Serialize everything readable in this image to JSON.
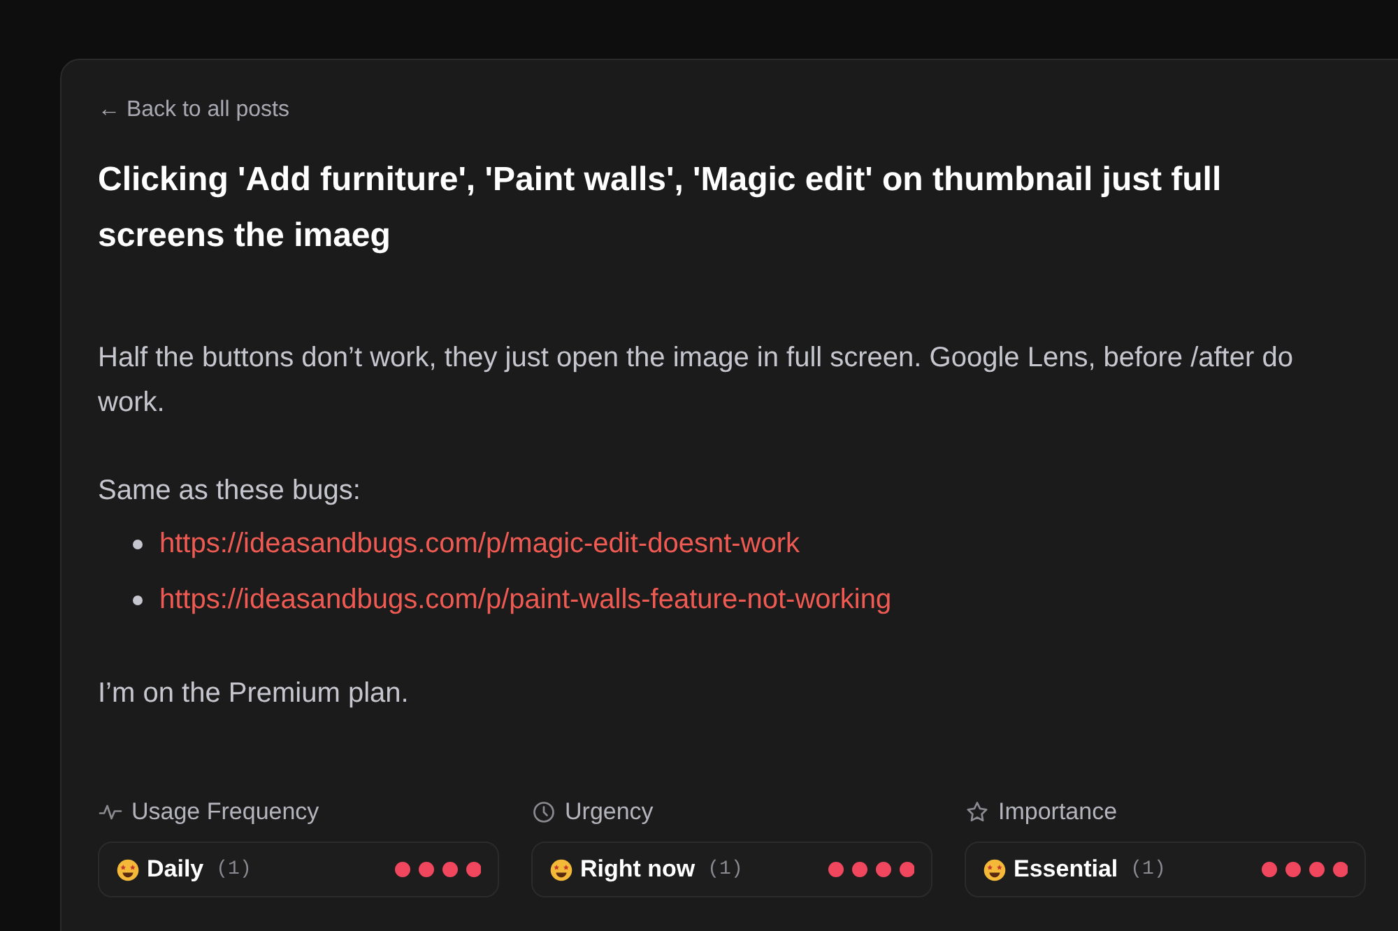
{
  "back_link": "← Back to all posts",
  "title": "Clicking 'Add furniture', 'Paint walls', 'Magic edit' on thumbnail just full screens the imaeg",
  "body": {
    "intro": "Half the buttons don’t work, they just open the image in full screen. Google Lens, before /after do work.",
    "lead": "Same as these bugs:",
    "links": [
      "https://ideasandbugs.com/p/magic-edit-doesnt-work",
      "https://ideasandbugs.com/p/paint-walls-feature-not-working"
    ],
    "outro": "I’m on the Premium plan."
  },
  "metrics": [
    {
      "kind": "frequency",
      "label": "Usage Frequency",
      "value": "Daily",
      "count": "(1)",
      "stars": 4
    },
    {
      "kind": "urgency",
      "label": "Urgency",
      "value": "Right now",
      "count": "(1)",
      "stars": 4
    },
    {
      "kind": "importance",
      "label": "Importance",
      "value": "Essential",
      "count": "(1)",
      "stars": 4
    }
  ]
}
